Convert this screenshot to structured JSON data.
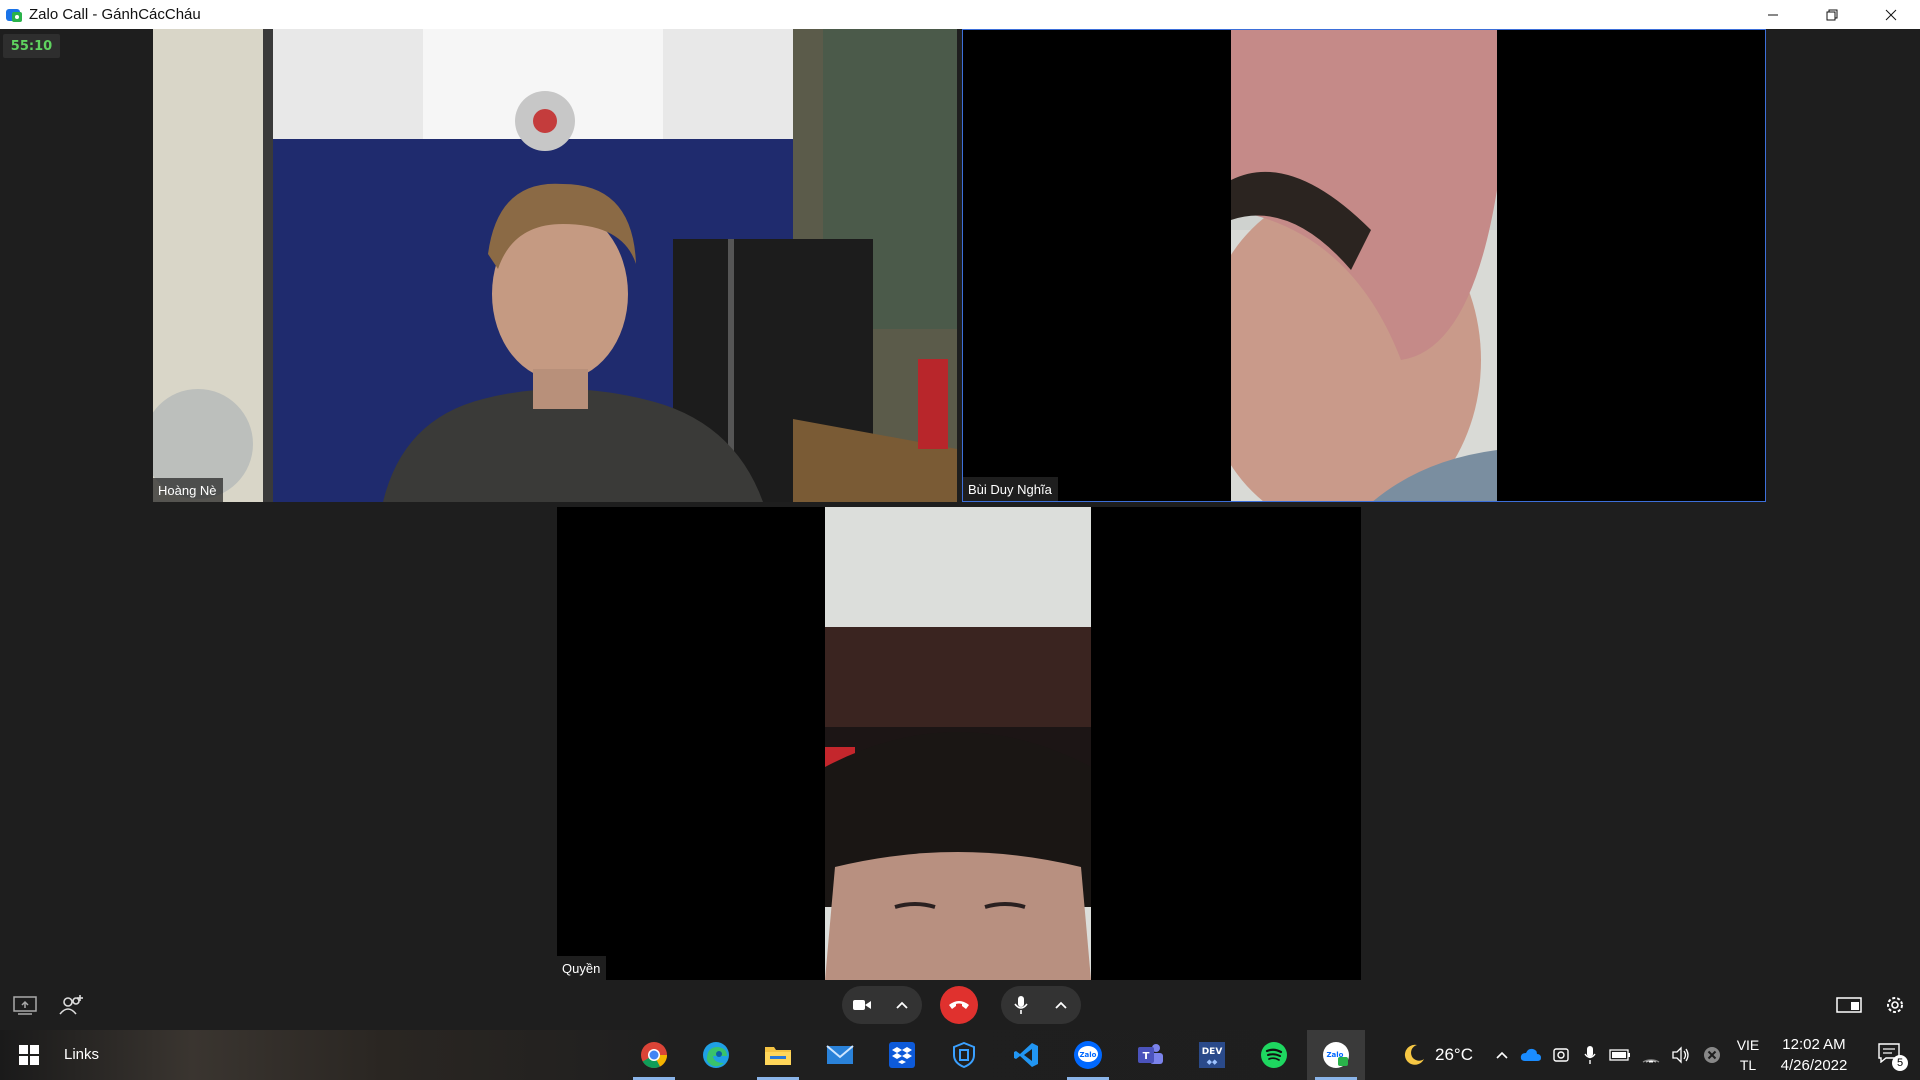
{
  "window": {
    "title": "Zalo Call - GánhCácCháu"
  },
  "call": {
    "timer": "55:10",
    "participants": [
      {
        "name": "Hoàng Nè"
      },
      {
        "name": "Bùi Duy Nghĩa"
      },
      {
        "name": "Quyền"
      }
    ]
  },
  "toolbar": {
    "icons": [
      "share-screen-icon",
      "add-member-icon",
      "camera-icon",
      "chevron-up-icon",
      "hangup-icon",
      "microphone-icon",
      "chevron-up-icon",
      "layout-icon",
      "settings-icon"
    ]
  },
  "taskbar": {
    "links_label": "Links",
    "apps": [
      "Google Chrome",
      "Microsoft Edge",
      "File Explorer",
      "Mail",
      "Dropbox",
      "Windows Security",
      "Visual Studio Code",
      "Zalo",
      "Microsoft Teams",
      "Dev Home",
      "Spotify",
      "Zalo Call"
    ],
    "weather": "26°C",
    "language_top": "VIE",
    "language_bottom": "TL",
    "time": "12:02 AM",
    "date": "4/26/2022",
    "notification_count": "5"
  },
  "colors": {
    "timer_text": "#5fd35f",
    "hangup": "#e0312e",
    "active_border": "#3d6fd9",
    "background": "#1e1e1e"
  }
}
